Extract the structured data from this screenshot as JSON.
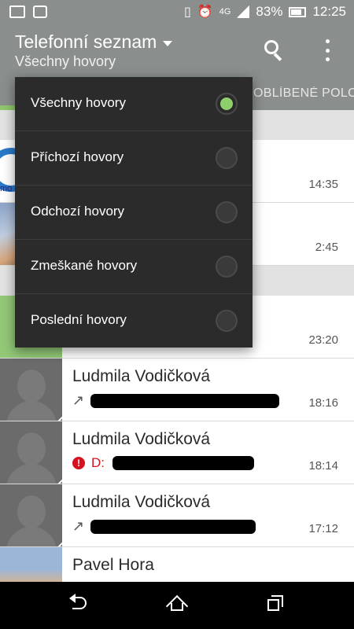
{
  "status_bar": {
    "network": "4G",
    "battery": "83%",
    "time": "12:25"
  },
  "app_bar": {
    "title": "Telefonní seznam",
    "subtitle": "Všechny hovory"
  },
  "tabs": {
    "favorites_label": "OBLÍBENÉ POLOŽKY"
  },
  "dropdown": {
    "items": [
      {
        "label": "Všechny hovory",
        "selected": true
      },
      {
        "label": "Příchozí hovory",
        "selected": false
      },
      {
        "label": "Odchozí hovory",
        "selected": false
      },
      {
        "label": "Zmeškané hovory",
        "selected": false
      },
      {
        "label": "Poslední hovory",
        "selected": false
      }
    ]
  },
  "call_log": [
    {
      "time": "14:35"
    },
    {
      "time": "2:45"
    },
    {
      "time": "23:20"
    },
    {
      "name": "Ludmila Vodičková",
      "type": "outgoing",
      "time": "18:16"
    },
    {
      "name": "Ludmila Vodičková",
      "type": "missed",
      "type_label": "D:",
      "time": "18:14"
    },
    {
      "name": "Ludmila Vodičková",
      "type": "outgoing",
      "time": "17:12"
    },
    {
      "name": "Pavel Hora"
    }
  ],
  "colors": {
    "app_bar": "#8a8f8d",
    "accent_green": "#8fd06d",
    "dropdown_bg": "#2b2b2b",
    "missed_red": "#d5121d"
  }
}
